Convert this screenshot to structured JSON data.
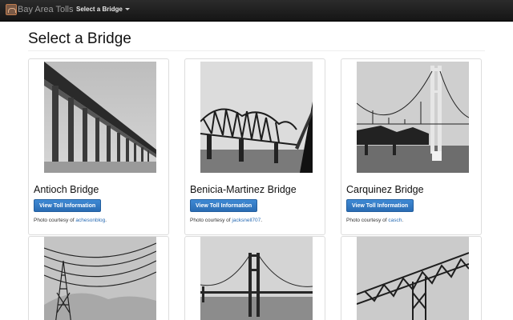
{
  "navbar": {
    "brand": "Bay Area Tolls",
    "dropdown_label": "Select a Bridge",
    "logo_icon": "bridge-logo-icon"
  },
  "page": {
    "title": "Select a Bridge"
  },
  "bridges": [
    {
      "name": "Antioch Bridge",
      "button_label": "View Toll Information",
      "credit_prefix": "Photo courtesy of",
      "credit_link": "achesonblog",
      "credit_suffix": "."
    },
    {
      "name": "Benicia-Martinez Bridge",
      "button_label": "View Toll Information",
      "credit_prefix": "Photo courtesy of",
      "credit_link": "jacksnell707",
      "credit_suffix": "."
    },
    {
      "name": "Carquinez Bridge",
      "button_label": "View Toll Information",
      "credit_prefix": "Photo courtesy of",
      "credit_link": "casch",
      "credit_suffix": "."
    }
  ],
  "colors": {
    "navbar": "#1b1b1b",
    "button": "#2f76c4",
    "link": "#2a6cb4"
  }
}
